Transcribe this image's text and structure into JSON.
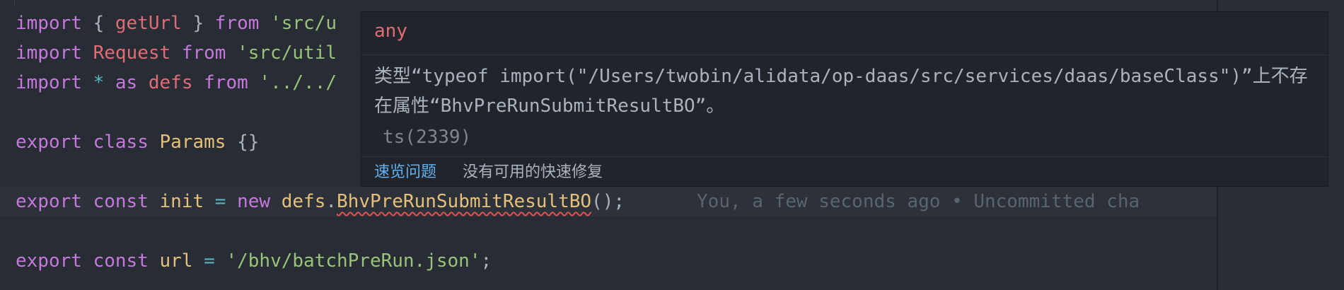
{
  "editor": {
    "lines": [
      {
        "tokens": [
          {
            "t": "import",
            "c": "kw"
          },
          {
            "t": " { ",
            "c": "punc"
          },
          {
            "t": "getUrl",
            "c": "var"
          },
          {
            "t": " } ",
            "c": "punc"
          },
          {
            "t": "from",
            "c": "kw"
          },
          {
            "t": " ",
            "c": "punc"
          },
          {
            "t": "'src/u",
            "c": "str"
          }
        ]
      },
      {
        "tokens": [
          {
            "t": "import",
            "c": "kw"
          },
          {
            "t": " ",
            "c": "punc"
          },
          {
            "t": "Request",
            "c": "var"
          },
          {
            "t": " ",
            "c": "punc"
          },
          {
            "t": "from",
            "c": "kw"
          },
          {
            "t": " ",
            "c": "punc"
          },
          {
            "t": "'src/util",
            "c": "str"
          }
        ]
      },
      {
        "tokens": [
          {
            "t": "import",
            "c": "kw"
          },
          {
            "t": " ",
            "c": "punc"
          },
          {
            "t": "*",
            "c": "op"
          },
          {
            "t": " ",
            "c": "punc"
          },
          {
            "t": "as",
            "c": "kw"
          },
          {
            "t": " ",
            "c": "punc"
          },
          {
            "t": "defs",
            "c": "var"
          },
          {
            "t": " ",
            "c": "punc"
          },
          {
            "t": "from",
            "c": "kw"
          },
          {
            "t": " ",
            "c": "punc"
          },
          {
            "t": "'../../",
            "c": "str"
          }
        ]
      },
      {
        "tokens": []
      },
      {
        "tokens": [
          {
            "t": "export",
            "c": "kw"
          },
          {
            "t": " ",
            "c": "punc"
          },
          {
            "t": "class",
            "c": "kw"
          },
          {
            "t": " ",
            "c": "punc"
          },
          {
            "t": "Params",
            "c": "cls"
          },
          {
            "t": " {}",
            "c": "punc"
          }
        ]
      },
      {
        "tokens": []
      },
      {
        "current": true,
        "tokens": [
          {
            "t": "export",
            "c": "kw"
          },
          {
            "t": " ",
            "c": "punc"
          },
          {
            "t": "const",
            "c": "kw"
          },
          {
            "t": " ",
            "c": "punc"
          },
          {
            "t": "init",
            "c": "cls"
          },
          {
            "t": " ",
            "c": "punc"
          },
          {
            "t": "=",
            "c": "op"
          },
          {
            "t": " ",
            "c": "punc"
          },
          {
            "t": "new",
            "c": "kw"
          },
          {
            "t": " ",
            "c": "punc"
          },
          {
            "t": "defs",
            "c": "cls"
          },
          {
            "t": ".",
            "c": "punc"
          },
          {
            "t": "BhvPreRunSubmitResultBO",
            "c": "cls squiggle"
          },
          {
            "t": "();",
            "c": "punc"
          },
          {
            "t": "You, a few seconds ago • Uncommitted cha",
            "c": "blame"
          }
        ]
      },
      {
        "tokens": []
      },
      {
        "tokens": [
          {
            "t": "export",
            "c": "kw"
          },
          {
            "t": " ",
            "c": "punc"
          },
          {
            "t": "const",
            "c": "kw"
          },
          {
            "t": " ",
            "c": "punc"
          },
          {
            "t": "url",
            "c": "cls"
          },
          {
            "t": " ",
            "c": "punc"
          },
          {
            "t": "=",
            "c": "op"
          },
          {
            "t": " ",
            "c": "punc"
          },
          {
            "t": "'/bhv/batchPreRun.json'",
            "c": "str"
          },
          {
            "t": ";",
            "c": "punc"
          }
        ]
      }
    ]
  },
  "hover": {
    "type": "any",
    "message": "类型“typeof import(\"/Users/twobin/alidata/op-daas/src/services/daas/baseClass\")”上不存在属性“BhvPreRunSubmitResultBO”。",
    "code": "ts(2339)",
    "peek_label": "速览问题",
    "no_fix_label": "没有可用的快速修复"
  },
  "colors": {
    "background": "#282c34",
    "keyword": "#c678dd",
    "variable": "#e06c75",
    "string": "#98c379",
    "class": "#e5c07b",
    "link": "#61afef"
  }
}
